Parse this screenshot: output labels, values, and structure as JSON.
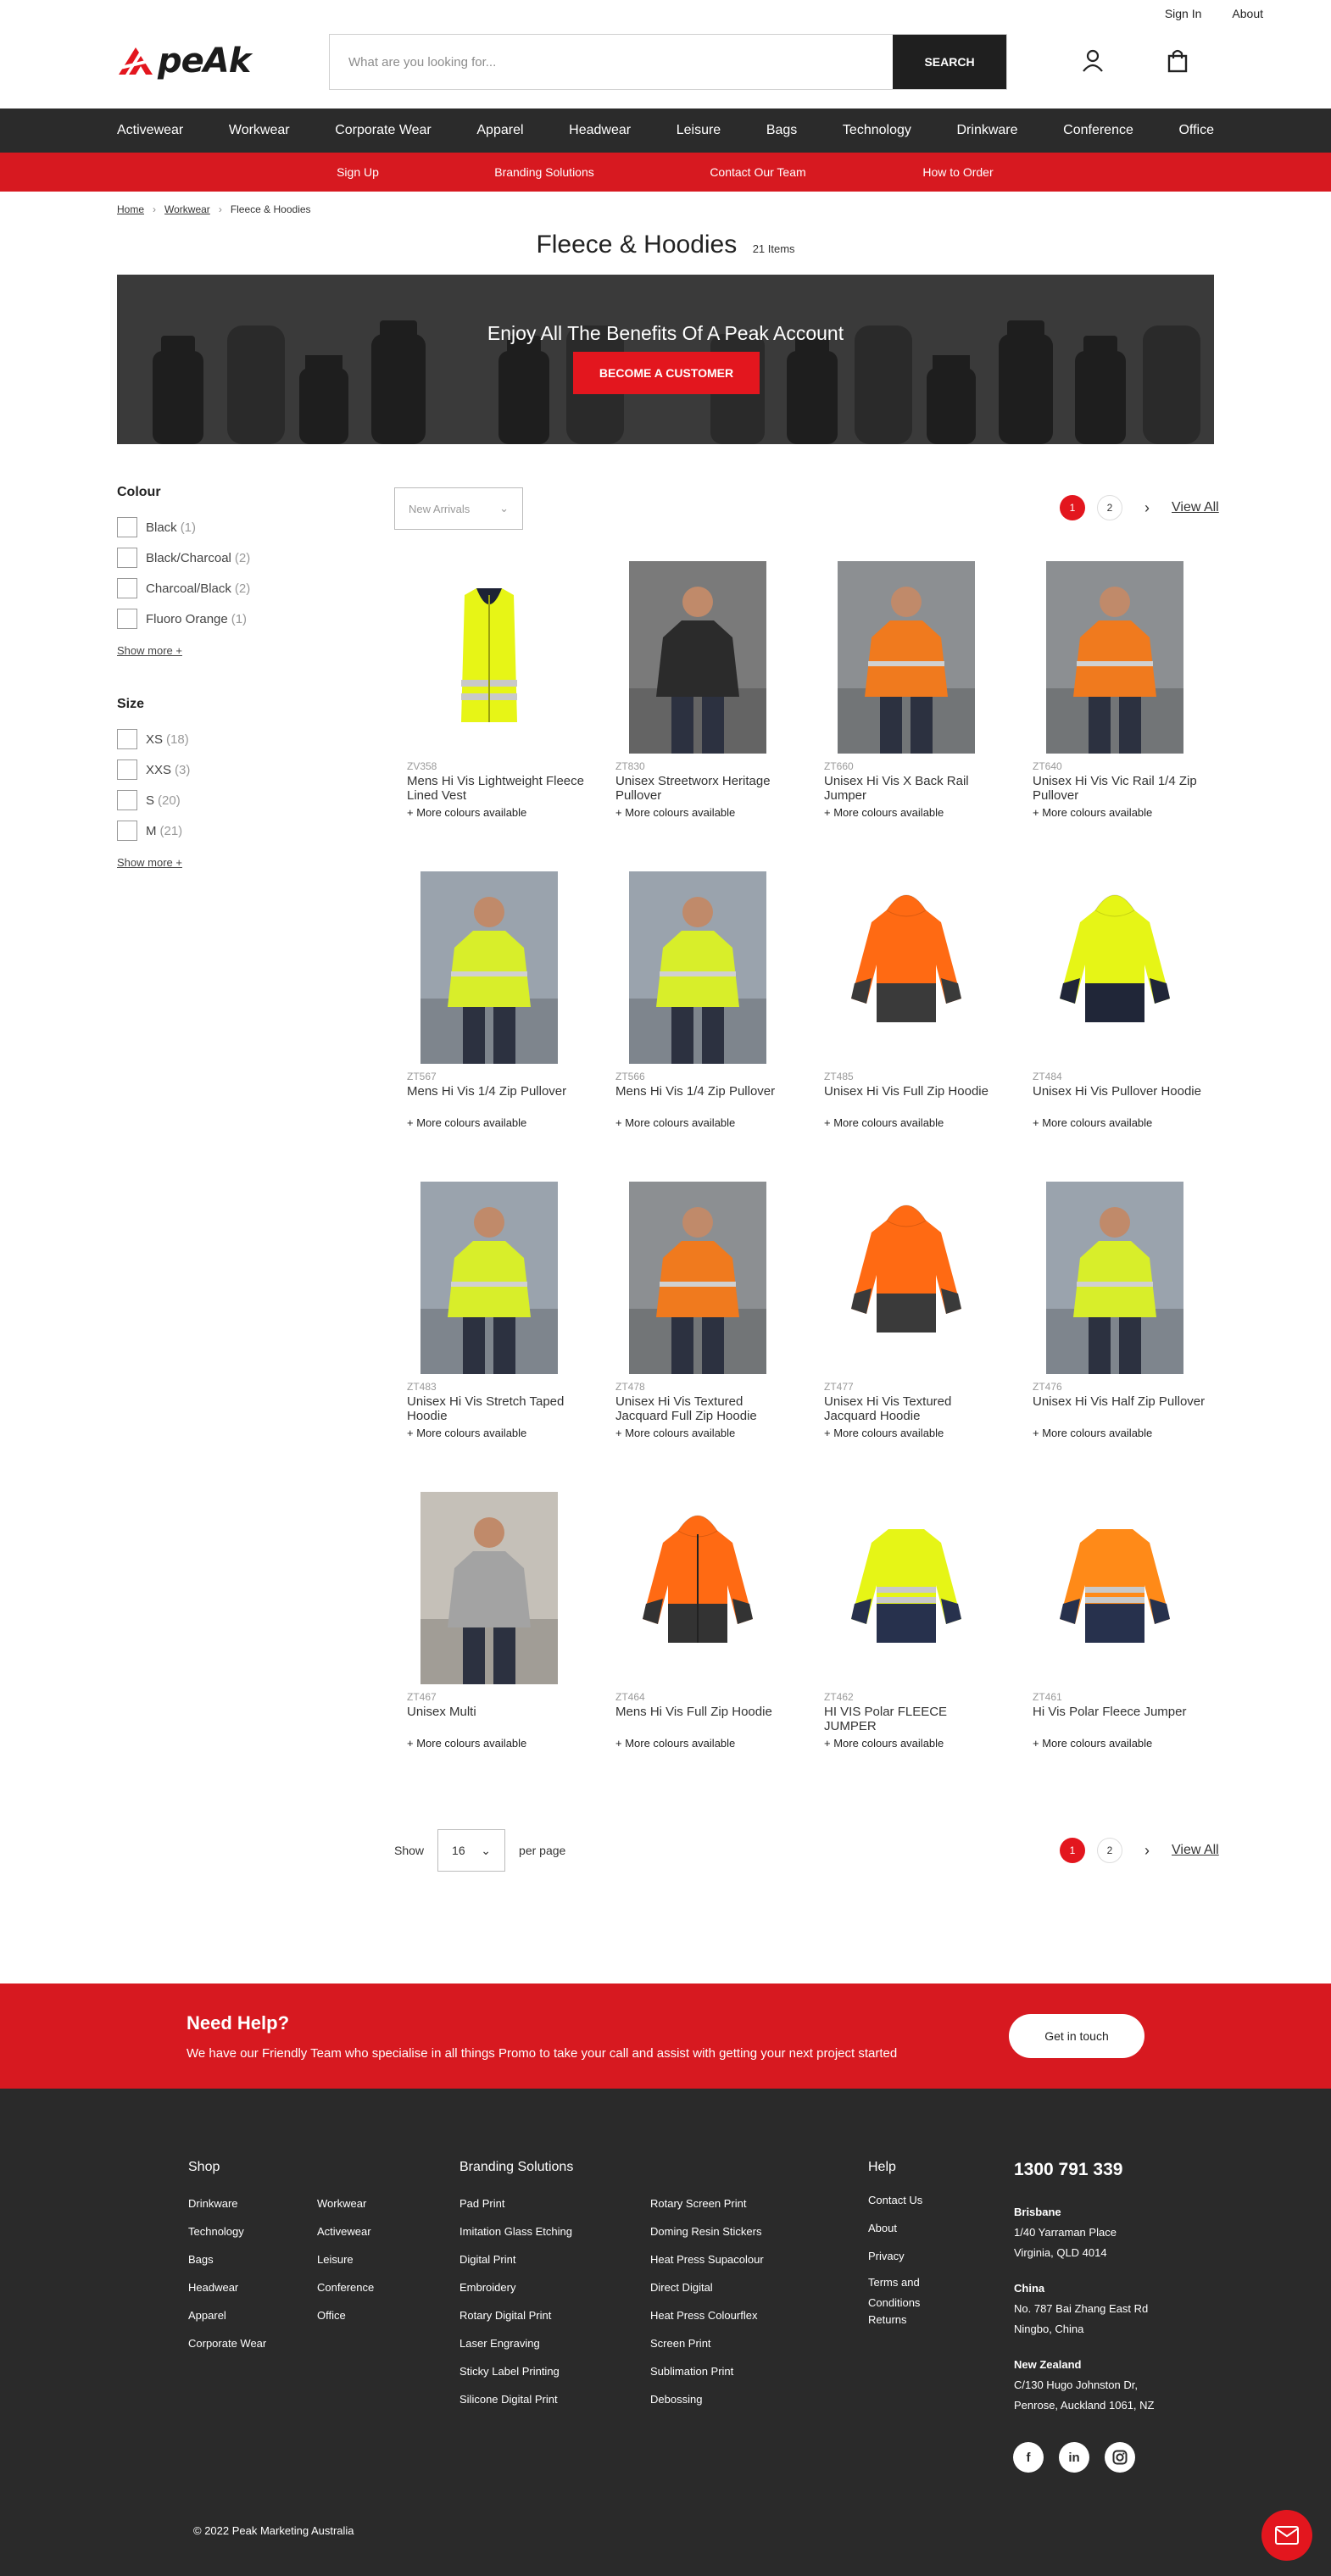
{
  "header": {
    "top_links": [
      "Sign In",
      "About"
    ],
    "logo_text": "peAk",
    "search": {
      "placeholder": "What are you looking for...",
      "button": "SEARCH"
    },
    "icons": [
      "account-icon",
      "bag-icon"
    ]
  },
  "main_nav": [
    "Activewear",
    "Workwear",
    "Corporate Wear",
    "Apparel",
    "Headwear",
    "Leisure",
    "Bags",
    "Technology",
    "Drinkware",
    "Conference",
    "Office"
  ],
  "sub_nav": [
    "Sign Up",
    "Branding Solutions",
    "Contact Our Team",
    "How to Order"
  ],
  "breadcrumb": [
    "Home",
    "Workwear",
    "Fleece & Hoodies"
  ],
  "page": {
    "title": "Fleece & Hoodies",
    "count": "21 Items"
  },
  "banner": {
    "title": "Enjoy All The Benefits Of A Peak Account",
    "button": "BECOME A CUSTOMER"
  },
  "filters": {
    "colour": {
      "title": "Colour",
      "options": [
        {
          "label": "Black",
          "count": "(1)"
        },
        {
          "label": "Black/Charcoal",
          "count": "(2)"
        },
        {
          "label": "Charcoal/Black",
          "count": "(2)"
        },
        {
          "label": "Fluoro Orange",
          "count": "(1)"
        }
      ],
      "more": "Show more +"
    },
    "size": {
      "title": "Size",
      "options": [
        {
          "label": "XS",
          "count": "(18)"
        },
        {
          "label": "XXS",
          "count": "(3)"
        },
        {
          "label": "S",
          "count": "(20)"
        },
        {
          "label": "M",
          "count": "(21)"
        }
      ],
      "more": "Show more +"
    }
  },
  "sort": {
    "value": "New Arrivals"
  },
  "pagination": {
    "pages": [
      "1",
      "2"
    ],
    "view_all": "View All"
  },
  "products": [
    {
      "code": "ZV358",
      "name": "Mens Hi Vis Lightweight Fleece Lined Vest",
      "more": "+ More colours available"
    },
    {
      "code": "ZT830",
      "name": "Unisex Streetworx Heritage Pullover",
      "more": "+ More colours available"
    },
    {
      "code": "ZT660",
      "name": "Unisex Hi Vis X Back Rail Jumper",
      "more": "+ More colours available"
    },
    {
      "code": "ZT640",
      "name": "Unisex Hi Vis Vic Rail 1/4 Zip Pullover",
      "more": "+ More colours available"
    },
    {
      "code": "ZT567",
      "name": "Mens Hi Vis 1/4 Zip Pullover",
      "more": "+ More colours available"
    },
    {
      "code": "ZT566",
      "name": "Mens Hi Vis 1/4 Zip Pullover",
      "more": "+ More colours available"
    },
    {
      "code": "ZT485",
      "name": "Unisex Hi Vis Full Zip Hoodie",
      "more": "+ More colours available"
    },
    {
      "code": "ZT484",
      "name": "Unisex Hi Vis Pullover Hoodie",
      "more": "+ More colours available"
    },
    {
      "code": "ZT483",
      "name": "Unisex Hi Vis Stretch Taped Hoodie",
      "more": "+ More colours available"
    },
    {
      "code": "ZT478",
      "name": "Unisex Hi Vis Textured Jacquard Full Zip Hoodie",
      "more": "+ More colours available"
    },
    {
      "code": "ZT477",
      "name": "Unisex Hi Vis Textured Jacquard Hoodie",
      "more": "+ More colours available"
    },
    {
      "code": "ZT476",
      "name": "Unisex Hi Vis Half Zip Pullover",
      "more": "+ More colours available"
    },
    {
      "code": "ZT467",
      "name": "Unisex Multi",
      "more": "+ More colours available"
    },
    {
      "code": "ZT464",
      "name": "Mens Hi Vis Full Zip Hoodie",
      "more": "+ More colours available"
    },
    {
      "code": "ZT462",
      "name": "HI VIS Polar FLEECE JUMPER",
      "more": "+ More colours available"
    },
    {
      "code": "ZT461",
      "name": "Hi Vis Polar Fleece Jumper",
      "more": "+ More colours available"
    }
  ],
  "per_page": {
    "label_before": "Show",
    "value": "16",
    "label_after": "per page"
  },
  "help": {
    "title": "Need Help?",
    "text": "We have our Friendly Team who specialise in all things Promo to take your call and assist with getting your next project started",
    "button": "Get in touch"
  },
  "footer": {
    "shop": {
      "title": "Shop",
      "col1": [
        "Drinkware",
        "Technology",
        "Bags",
        "Headwear",
        "Apparel",
        "Corporate Wear"
      ],
      "col2": [
        "Workwear",
        "Activewear",
        "Leisure",
        "Conference",
        "Office"
      ]
    },
    "branding": {
      "title": "Branding Solutions",
      "col1": [
        "Pad Print",
        "Imitation Glass Etching",
        "Digital Print",
        "Embroidery",
        "Rotary Digital Print",
        "Laser Engraving",
        "Sticky Label Printing",
        "Silicone Digital Print"
      ],
      "col2": [
        "Rotary Screen Print",
        "Doming Resin Stickers",
        "Heat Press Supacolour",
        "Direct Digital",
        "Heat Press Colourflex",
        "Screen Print",
        "Sublimation Print",
        "Debossing"
      ]
    },
    "help": {
      "title": "Help",
      "links": [
        "Contact Us",
        "About",
        "Privacy",
        "Terms and Conditions",
        "Returns"
      ]
    },
    "phone": "1300 791 339",
    "offices": [
      {
        "name": "Brisbane",
        "lines": [
          "1/40 Yarraman Place",
          "Virginia, QLD 4014"
        ]
      },
      {
        "name": "China",
        "lines": [
          "No. 787 Bai Zhang East Rd",
          "Ningbo, China"
        ]
      },
      {
        "name": "New Zealand",
        "lines": [
          "C/130 Hugo Johnston Dr,",
          "Penrose, Auckland 1061, NZ"
        ]
      }
    ],
    "social": [
      "facebook-icon",
      "linkedin-icon",
      "instagram-icon"
    ],
    "copyright": "© 2022 Peak Marketing Australia"
  },
  "colors": {
    "brand_red": "#d71920",
    "dark": "#2b2b2b",
    "footer": "#2a2a2a"
  }
}
